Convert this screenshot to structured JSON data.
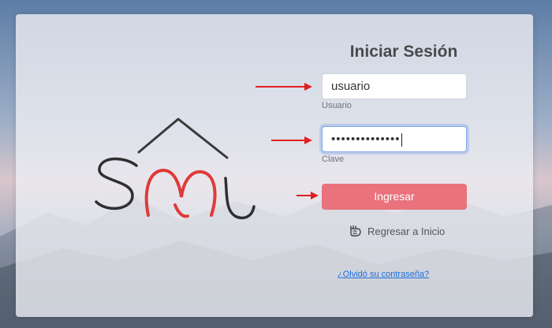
{
  "login": {
    "title": "Iniciar Sesión",
    "username_value": "usuario",
    "username_label": "Usuario",
    "password_value": "••••••••••••••",
    "password_label": "Clave",
    "submit_label": "Ingresar",
    "back_label": "Regresar a Inicio",
    "forgot_label": "¿Olvidó su contraseña?"
  },
  "colors": {
    "button": "#e9727c",
    "link": "#1d6fe0",
    "arrow": "#e02020",
    "logo_red": "#e03a3a"
  },
  "icons": {
    "back": "hand-back-icon"
  }
}
